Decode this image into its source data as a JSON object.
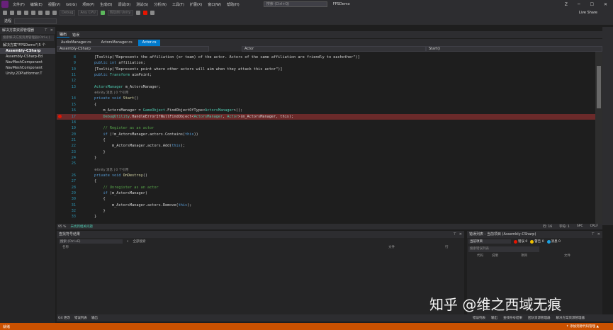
{
  "titlebar": {
    "menu": [
      "文件(F)",
      "编辑(E)",
      "视图(V)",
      "Git(G)",
      "项目(P)",
      "生成(B)",
      "调试(D)",
      "测试(S)",
      "分析(N)",
      "工具(T)",
      "扩展(X)",
      "窗口(W)",
      "帮助(H)"
    ],
    "search_placeholder": "搜索 (Ctrl+Q)",
    "project_name": "FPSDemo",
    "avatar": "Z"
  },
  "toolbar": {
    "config": "Debug",
    "platform": "Any CPU",
    "attach": "附加到 Unity",
    "live_share": "Live Share"
  },
  "toolbar2": {
    "label": "选程"
  },
  "solution_explorer": {
    "title": "解决方案资源管理器",
    "search_placeholder": "搜索解决方案资源管理器(Ctrl+;)",
    "items": [
      {
        "label": "解决方案\"FPSDemo\"(5 个",
        "selected": false
      },
      {
        "label": "Assembly-CSharp",
        "selected": true
      },
      {
        "label": "Assembly-CSharp-Ed",
        "selected": false
      },
      {
        "label": "NavMeshComponent",
        "selected": false
      },
      {
        "label": "NavMeshComponent",
        "selected": false
      },
      {
        "label": "Unity.2DPlatformer.T",
        "selected": false
      }
    ]
  },
  "panel_tabs": [
    "输出",
    "错误"
  ],
  "editor": {
    "tabs": [
      {
        "label": "AudioManager.cs",
        "active": false
      },
      {
        "label": "ActorsManager.cs",
        "active": false
      },
      {
        "label": "Actor.cs",
        "active": true
      }
    ],
    "nav": {
      "project": "Assembly-CSharp",
      "class": "Actor",
      "member": "Start()"
    },
    "lines": [
      {
        "n": "8",
        "parts": [
          [
            "",
            "[Tooltip(\"Represents the affiliation (or team) of the actor. Actors of the same affiliation are friendly to eachother\")]"
          ]
        ]
      },
      {
        "n": "9",
        "parts": [
          [
            "kw",
            "public int "
          ],
          [
            "",
            "affiliation;"
          ]
        ]
      },
      {
        "n": "10",
        "parts": [
          [
            "",
            "[Tooltip(\"Represents point where other actors will aim when they attack this actor\")]"
          ]
        ]
      },
      {
        "n": "11",
        "parts": [
          [
            "kw",
            "public "
          ],
          [
            "ty",
            "Transform "
          ],
          [
            "",
            "aimPoint;"
          ]
        ]
      },
      {
        "n": "12",
        "parts": []
      },
      {
        "n": "13",
        "parts": [
          [
            "ty",
            "ActorsManager "
          ],
          [
            "",
            "m_ActorsManager;"
          ]
        ]
      },
      {
        "n": "",
        "parts": [
          [
            "ref",
            "⊕Unity 消息 | 0 个引用"
          ]
        ]
      },
      {
        "n": "14",
        "parts": [
          [
            "kw",
            "private void "
          ],
          [
            "mt",
            "Start"
          ],
          [
            "",
            "()"
          ]
        ]
      },
      {
        "n": "15",
        "parts": [
          [
            "",
            "{"
          ]
        ]
      },
      {
        "n": "16",
        "parts": [
          [
            "",
            "    m_ActorsManager = "
          ],
          [
            "ty",
            "GameObject"
          ],
          [
            "",
            ".FindObjectOfType<"
          ],
          [
            "ty",
            "ActorsManager"
          ],
          [
            "",
            ">();"
          ]
        ]
      },
      {
        "n": "17",
        "parts": [
          [
            "ty",
            "    DebugUtility"
          ],
          [
            "",
            ".HandleErrorIfNullFindObject<"
          ],
          [
            "ty",
            "ActorsManager"
          ],
          [
            "",
            ", "
          ],
          [
            "ty",
            "Actor"
          ],
          [
            "",
            ">(m_ActorsManager, this);"
          ]
        ],
        "highlight": true,
        "breakpoint": true
      },
      {
        "n": "18",
        "parts": []
      },
      {
        "n": "19",
        "parts": [
          [
            "cm",
            "    // Register as an actor"
          ]
        ]
      },
      {
        "n": "20",
        "parts": [
          [
            "kw",
            "    if "
          ],
          [
            "",
            "(!m_ActorsManager.actors.Contains("
          ],
          [
            "kw",
            "this"
          ],
          [
            "",
            "))"
          ]
        ]
      },
      {
        "n": "21",
        "parts": [
          [
            "",
            "    {"
          ]
        ]
      },
      {
        "n": "22",
        "parts": [
          [
            "",
            "        m_ActorsManager.actors.Add("
          ],
          [
            "kw",
            "this"
          ],
          [
            "",
            ");"
          ]
        ]
      },
      {
        "n": "23",
        "parts": [
          [
            "",
            "    }"
          ]
        ]
      },
      {
        "n": "24",
        "parts": [
          [
            "",
            "}"
          ]
        ]
      },
      {
        "n": "25",
        "parts": []
      },
      {
        "n": "",
        "parts": [
          [
            "ref",
            "⊕Unity 消息 | 0 个引用"
          ]
        ]
      },
      {
        "n": "26",
        "parts": [
          [
            "kw",
            "private void "
          ],
          [
            "mt",
            "OnDestroy"
          ],
          [
            "",
            "()"
          ]
        ]
      },
      {
        "n": "27",
        "parts": [
          [
            "",
            "{"
          ]
        ]
      },
      {
        "n": "28",
        "parts": [
          [
            "cm",
            "    // Unregister as an actor"
          ]
        ]
      },
      {
        "n": "29",
        "parts": [
          [
            "kw",
            "    if "
          ],
          [
            "",
            "(m_ActorsManager)"
          ]
        ]
      },
      {
        "n": "30",
        "parts": [
          [
            "",
            "    {"
          ]
        ]
      },
      {
        "n": "31",
        "parts": [
          [
            "",
            "        m_ActorsManager.actors.Remove("
          ],
          [
            "kw",
            "this"
          ],
          [
            "",
            ");"
          ]
        ]
      },
      {
        "n": "32",
        "parts": [
          [
            "",
            "    }"
          ]
        ]
      },
      {
        "n": "33",
        "parts": [
          [
            "",
            "}"
          ]
        ]
      }
    ]
  },
  "statusline": {
    "zoom": "95 %",
    "issues": "未找到相关问题",
    "line": "行: 16",
    "col": "字符: 1",
    "spaces": "SPC",
    "eol": "CRLF"
  },
  "output": {
    "title": "查找符号结果",
    "search_placeholder": "搜索 (Ctrl+E)",
    "search_all": "全部搜索",
    "columns": [
      "名称",
      "文件",
      "行"
    ]
  },
  "errlist": {
    "title": "错误列表 - 当前项目 (Assembly-CSharp)",
    "scope": "当前项目",
    "errors": "错误 0",
    "warnings": "警告 0",
    "messages": "消息 0",
    "search_placeholder": "搜索错误列表",
    "columns": [
      "代码",
      "说明",
      "项目",
      "文件"
    ]
  },
  "bottomtabs": {
    "left": [
      "Git 更改",
      "错误列表",
      "输出"
    ],
    "right": [
      "错误列表",
      "输出",
      "查找符号结果",
      "团队资源管理器",
      "解决方案资源管理器"
    ]
  },
  "statusbar": {
    "ready": "就绪",
    "source_control": "↑ 添加到源代码管理 ▲"
  },
  "watermark": "知乎 @维之西域无痕"
}
